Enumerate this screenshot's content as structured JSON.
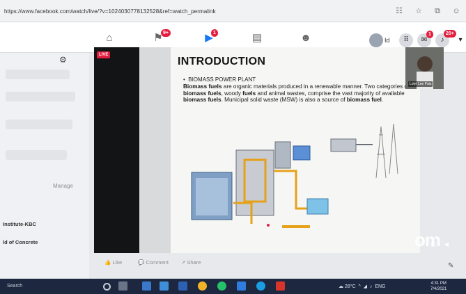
{
  "browser": {
    "url": "https://www.facebook.com/watch/live/?v=1024030778132528&ref=watch_permalink"
  },
  "nav": {
    "badges": {
      "pages": "9+",
      "watch": "1",
      "messenger": "1",
      "notifications": "20+"
    },
    "profile_label": "Id"
  },
  "sidebar": {
    "manage_label": "Manage",
    "items": [
      "Institute-KBC",
      "ld of Concrete"
    ]
  },
  "video": {
    "live_label": "LIVE",
    "slide": {
      "title": "INTRODUCTION",
      "bullet": "BIOMASS POWER PLANT",
      "body": [
        {
          "t": "Biomass fuels",
          "b": true
        },
        {
          "t": " are organic materials produced in a renewable manner. Two categories of ",
          "b": false
        },
        {
          "t": "biomass fuels",
          "b": true
        },
        {
          "t": ", woody ",
          "b": false
        },
        {
          "t": "fuels",
          "b": true
        },
        {
          "t": " and animal wastes, comprise the vast majority of available ",
          "b": false
        },
        {
          "t": "biomass fuels",
          "b": true
        },
        {
          "t": ". Municipal solid waste (MSW) is also a source of ",
          "b": false
        },
        {
          "t": "biomass fuel",
          "b": true
        },
        {
          "t": ".",
          "b": false
        }
      ]
    },
    "webcam_name": "Lolyt Lee Pais",
    "watermark": "om"
  },
  "reactions": {
    "like": "Like",
    "comment": "Comment",
    "share": "Share"
  },
  "taskbar": {
    "search": "Search",
    "weather": "28°C",
    "time": "4:31 PM",
    "date": "7/4/2021"
  },
  "colors": {
    "fb_blue": "#1877f2",
    "badge_red": "#e41e3f",
    "taskbar": "#1d2740"
  }
}
